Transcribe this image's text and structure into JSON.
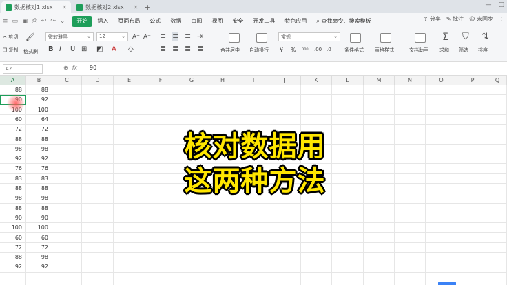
{
  "tabs": [
    {
      "label": "数据核对1.xlsx",
      "active": true
    },
    {
      "label": "数据核对2.xlsx",
      "active": false
    }
  ],
  "menu": {
    "items": [
      "开始",
      "插入",
      "页面布局",
      "公式",
      "数据",
      "审阅",
      "视图",
      "安全",
      "开发工具",
      "特色应用"
    ],
    "active": "开始",
    "search": "查找命令、搜索模板",
    "share": "分享",
    "comment": "批注",
    "sync": "未同步"
  },
  "ribbon": {
    "cut": "剪切",
    "copy": "复制",
    "format_painter": "格式刷",
    "font_name": "微软雅黑",
    "font_size": "12",
    "number_format": "常规",
    "merge_center": "合并居中",
    "wrap_text": "自动换行",
    "cond_format": "条件格式",
    "table_style": "表格样式",
    "doc_helper": "文档助手",
    "sum": "求和",
    "filter": "筛选",
    "sort": "排序"
  },
  "formula": {
    "name_box": "A2",
    "value": "90"
  },
  "columns": [
    "A",
    "B",
    "C",
    "D",
    "E",
    "F",
    "G",
    "H",
    "I",
    "J",
    "K",
    "L",
    "M",
    "N",
    "O",
    "P",
    "Q"
  ],
  "rows": [
    [
      "88",
      "88"
    ],
    [
      "90",
      "92"
    ],
    [
      "100",
      "100"
    ],
    [
      "60",
      "64"
    ],
    [
      "72",
      "72"
    ],
    [
      "88",
      "88"
    ],
    [
      "98",
      "98"
    ],
    [
      "92",
      "92"
    ],
    [
      "76",
      "76"
    ],
    [
      "83",
      "83"
    ],
    [
      "88",
      "88"
    ],
    [
      "98",
      "98"
    ],
    [
      "88",
      "88"
    ],
    [
      "90",
      "90"
    ],
    [
      "100",
      "100"
    ],
    [
      "60",
      "60"
    ],
    [
      "72",
      "72"
    ],
    [
      "88",
      "98"
    ],
    [
      "92",
      "92"
    ]
  ],
  "overlay": {
    "line1": "核对数据用",
    "line2": "这两种方法"
  },
  "colors": {
    "accent": "#1e9e5a",
    "overlay_text": "#ffe600"
  }
}
